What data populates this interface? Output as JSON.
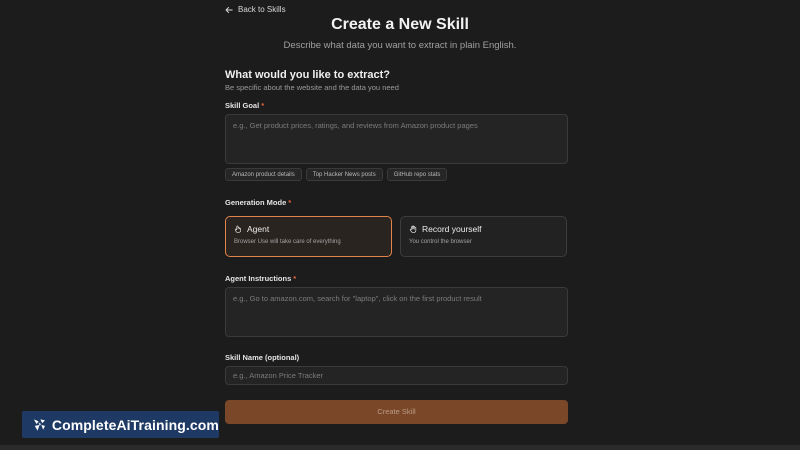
{
  "nav": {
    "back_label": "Back to Skills",
    "back_icon": "arrow-left-icon"
  },
  "header": {
    "title": "Create a New Skill",
    "subtitle": "Describe what data you want to extract in plain English."
  },
  "section": {
    "heading": "What would you like to extract?",
    "description": "Be specific about the website and the data you need"
  },
  "skill_goal": {
    "label": "Skill Goal",
    "required_mark": "*",
    "value": "",
    "placeholder": "e.g., Get product prices, ratings, and reviews from Amazon product pages",
    "examples": [
      "Amazon product details",
      "Top Hacker News posts",
      "GitHub repo stats"
    ]
  },
  "generation_mode": {
    "label": "Generation Mode",
    "required_mark": "*",
    "selected": "agent",
    "options": [
      {
        "id": "agent",
        "title": "Agent",
        "description": "Browser Use will take care of everything",
        "icon": "hand-pointer-icon"
      },
      {
        "id": "record",
        "title": "Record yourself",
        "description": "You control the browser",
        "icon": "hand-icon"
      }
    ]
  },
  "agent_instructions": {
    "label": "Agent Instructions",
    "required_mark": "*",
    "value": "",
    "placeholder": "e.g., Go to amazon.com, search for \"laptop\", click on the first product result"
  },
  "skill_name": {
    "label": "Skill Name (optional)",
    "value": "",
    "placeholder": "e.g., Amazon Price Tracker"
  },
  "submit": {
    "label": "Create Skill",
    "enabled": false
  },
  "watermark": {
    "text": "CompleteAiTraining.com"
  },
  "colors": {
    "background": "#1c1c1c",
    "accent": "#e0844a",
    "required": "#e2683a",
    "submit_bg": "#7a4828",
    "watermark_bg": "#1e3a64"
  }
}
